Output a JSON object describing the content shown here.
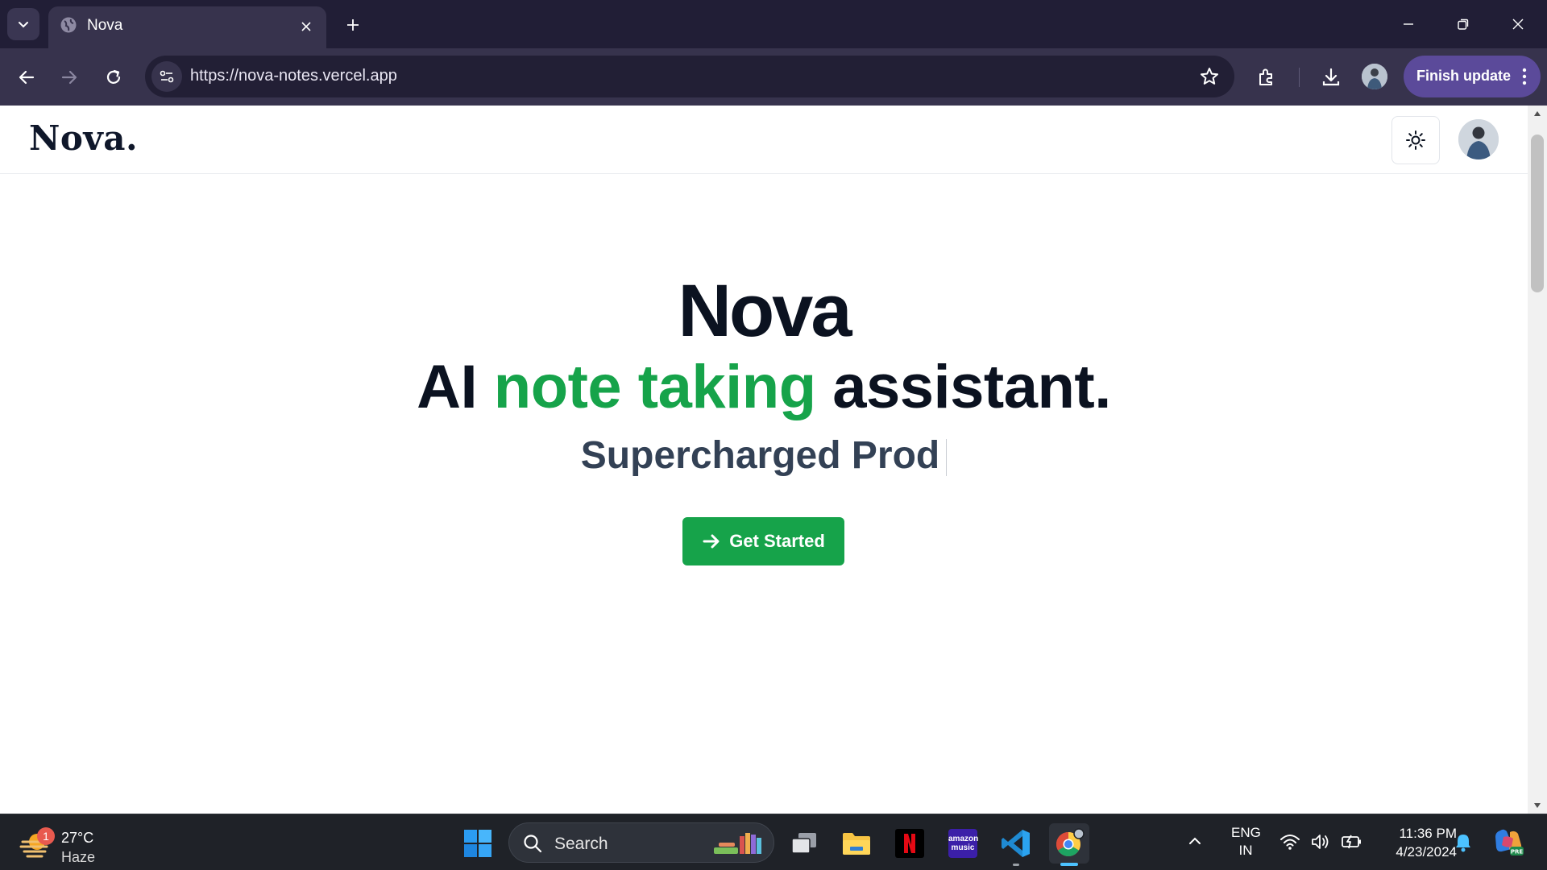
{
  "browser": {
    "tab": {
      "title": "Nova"
    },
    "address_bar": {
      "url": "https://nova-notes.vercel.app"
    },
    "finish_update_label": "Finish update"
  },
  "page": {
    "logo": "Nova.",
    "hero": {
      "title": "Nova",
      "subtitle_before": "AI ",
      "subtitle_accent": "note taking",
      "subtitle_after": " assistant.",
      "typing_text": "Supercharged Prod"
    },
    "cta_label": "Get Started"
  },
  "colors": {
    "accent_green": "#16a34a",
    "heading": "#0b1220",
    "browser_frame": "#211e36",
    "update_button": "#5b4a9a",
    "taskbar": "#1f2228"
  },
  "taskbar": {
    "weather": {
      "temp": "27°C",
      "condition": "Haze",
      "badge": "1"
    },
    "search_label": "Search",
    "apps": [
      "task-view",
      "file-explorer",
      "netflix",
      "amazon-music",
      "vs-code",
      "chrome"
    ],
    "amazon_music_text": "amazon music",
    "language": {
      "line1": "ENG",
      "line2": "IN"
    },
    "clock": {
      "time": "11:36 PM",
      "date": "4/23/2024"
    },
    "copilot_badge": "PRE"
  },
  "icons": {
    "tab_search": "chevron-down-icon",
    "tab_favicon": "globe-icon",
    "back": "arrow-left-icon",
    "forward": "arrow-right-icon",
    "reload": "reload-icon",
    "site_info": "tune-icon",
    "bookmark": "star-icon",
    "extensions": "puzzle-icon",
    "downloads": "download-icon",
    "menu": "kebab-menu-icon",
    "theme": "sun-icon"
  }
}
